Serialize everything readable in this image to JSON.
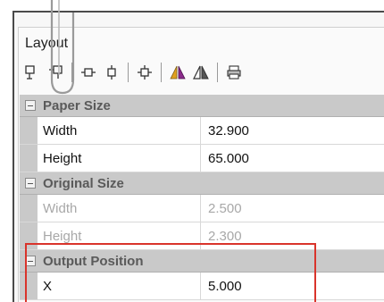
{
  "panel": {
    "title": "Layout"
  },
  "toolbar": {
    "buttons": [
      {
        "icon": "align-top-left-icon"
      },
      {
        "icon": "align-top-right-icon"
      },
      {
        "icon": "center-horizontal-icon"
      },
      {
        "icon": "center-vertical-icon"
      },
      {
        "icon": "center-both-icon"
      },
      {
        "icon": "flip-horizontal-color-icon"
      },
      {
        "icon": "mirror-icon"
      },
      {
        "icon": "print-icon"
      }
    ]
  },
  "sections": {
    "paper_size": {
      "label": "Paper Size",
      "width_label": "Width",
      "width_value": "32.900",
      "height_label": "Height",
      "height_value": "65.000"
    },
    "original_size": {
      "label": "Original Size",
      "width_label": "Width",
      "width_value": "2.500",
      "height_label": "Height",
      "height_value": "2.300"
    },
    "output_position": {
      "label": "Output Position",
      "x_label": "X",
      "x_value": "5.000"
    }
  },
  "colors": {
    "highlight": "#d9342b",
    "section_bg": "#c9c9c9",
    "disabled_text": "#a8a8a8"
  }
}
